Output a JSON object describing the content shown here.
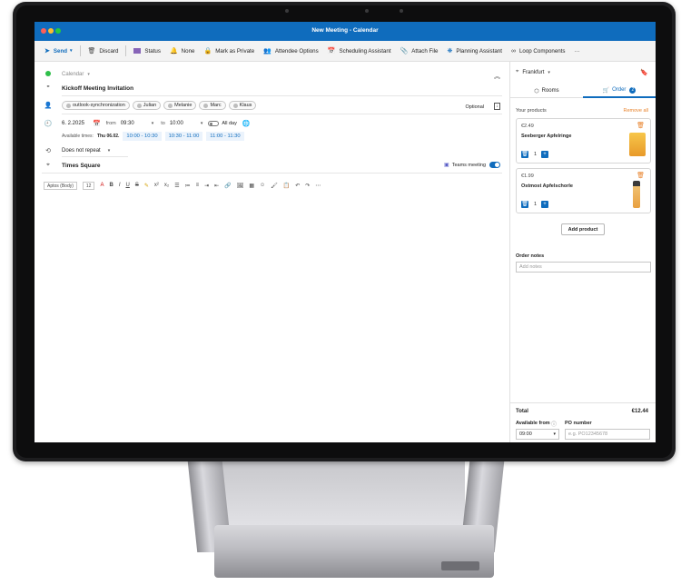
{
  "window": {
    "title": "New Meeting - Calendar"
  },
  "toolbar": {
    "send": "Send",
    "discard": "Discard",
    "status": "Status",
    "none": "None",
    "private": "Mark as Private",
    "attendee": "Attendee Options",
    "scheduling": "Scheduling Assistant",
    "attach": "Attach File",
    "planning": "Planning Assistant",
    "loop": "Loop Components",
    "more": "···"
  },
  "compose": {
    "calendar_label": "Calendar",
    "subject": "Kickoff Meeting Invitation",
    "attendees": [
      "outlook-synchronization",
      "Julian",
      "Melanie",
      "Marc",
      "Klaus"
    ],
    "optional_label": "Optional",
    "start_date": "6. 2.2025",
    "from_label": "from",
    "start_time": "09:30",
    "to_label": "to",
    "end_time": "10:00",
    "all_day_label": "All day",
    "available_label": "Available times:",
    "available_day": "Thu 06.02.",
    "slots": [
      "10:00 - 10:30",
      "10:30 - 11:00",
      "11:00 - 11:30"
    ],
    "repeat": "Does not repeat",
    "location": "Times Square",
    "teams_label": "Teams meeting",
    "font_name": "Aptos (Body)",
    "font_size": "12"
  },
  "order": {
    "location": "Frankfurt",
    "tab_rooms": "Rooms",
    "tab_order": "Order",
    "order_count": "2",
    "your_products": "Your products",
    "remove_all": "Remove all",
    "products": [
      {
        "price": "€2.49",
        "name": "Seeberger Apfelringe",
        "qty": "1"
      },
      {
        "price": "€1.99",
        "name": "Ostmost Apfelschorle",
        "qty": "1"
      }
    ],
    "add_product": "Add product",
    "order_notes_label": "Order notes",
    "order_notes_placeholder": "Add notes",
    "total_label": "Total",
    "total_value": "€12.44",
    "available_from_label": "Available from",
    "available_from_value": "09:00",
    "po_label": "PO number",
    "po_placeholder": "e.g. PO12345678"
  },
  "colors": {
    "accent": "#0f6cbd",
    "remove": "#e8822a",
    "titlebar": "#0f6cbd"
  }
}
